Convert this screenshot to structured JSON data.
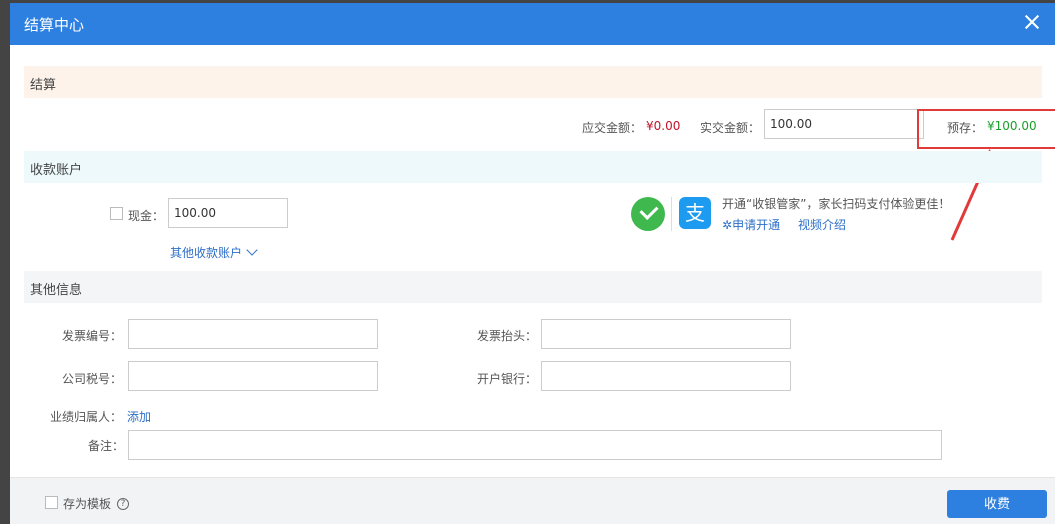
{
  "modal": {
    "title": "结算中心"
  },
  "settlement": {
    "section_title": "结算",
    "due_label": "应交金额：",
    "due_value": "¥0.00",
    "paid_label": "实交金额：",
    "paid_value": "100.00",
    "prepaid_label": "预存：",
    "prepaid_value": "¥100.00"
  },
  "accounts": {
    "section_title": "收款账户",
    "cash_label": "现金：",
    "cash_value": "100.00",
    "other_accounts_link": "其他收款账户",
    "promo_text": "开通“收银管家”，家长扫码支付体验更佳！",
    "apply_link": "申请开通",
    "video_link": "视频介绍"
  },
  "other_info": {
    "section_title": "其他信息",
    "invoice_no_label": "发票编号：",
    "invoice_title_label": "发票抬头：",
    "tax_no_label": "公司税号：",
    "bank_label": "开户银行：",
    "owner_label": "业绩归属人：",
    "owner_add_link": "添加",
    "remark_label": "备注："
  },
  "footer": {
    "save_template_label": "存为模板",
    "help_glyph": "?",
    "submit_label": "收费"
  },
  "colors": {
    "header": "#2d7fe0",
    "due": "#c0142a",
    "prepaid": "#1a9e2c",
    "highlight": "#e03a3a"
  }
}
